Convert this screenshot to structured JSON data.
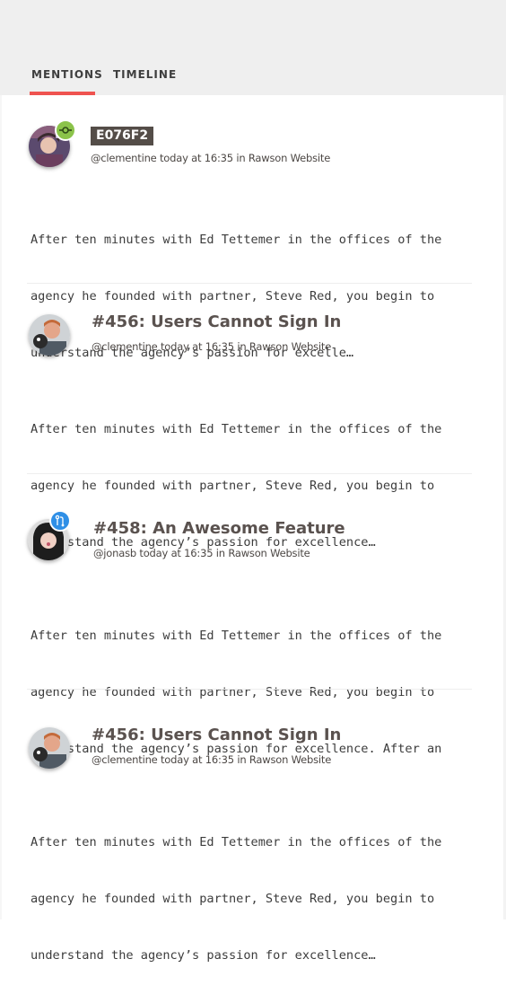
{
  "tabs": [
    {
      "label": "MENTIONS",
      "active": true
    },
    {
      "label": "TIMELINE",
      "active": false
    }
  ],
  "colors": {
    "accent": "#ef5350",
    "commit_badge": "#8bc34a",
    "pr_badge": "#2f8fe6",
    "hash_tag_bg": "#544d48"
  },
  "cards": [
    {
      "title": "E076F2",
      "title_style": "hash-tag",
      "meta": "@clementine today at 16:35 in Rawson Website",
      "badge_icon": "commit-icon",
      "body_lines": [
        "After ten minutes with Ed Tettemer in the offices of the",
        "agency he founded with partner, Steve Red, you begin to",
        "understand the agency’s passion for excelle…"
      ]
    },
    {
      "title": "#456: Users Cannot Sign In",
      "meta": "@clementine today at 16:35 in Rawson Website",
      "body_lines": [
        "After ten minutes with Ed Tettemer in the offices of the",
        "agency he founded with partner, Steve Red, you begin to",
        "understand the agency’s passion for excellence…"
      ]
    },
    {
      "title": "#458: An Awesome Feature",
      "meta": "@jonasb today at 16:35 in Rawson Website",
      "badge_icon": "pull-request-icon",
      "body_lines": [
        "After ten minutes with Ed Tettemer in the offices of the",
        "agency he founded with partner, Steve Red, you begin to",
        "understand the agency’s passion for excellence. After an"
      ]
    },
    {
      "title": "#456: Users Cannot Sign In",
      "meta": "@clementine today at 16:35 in Rawson Website",
      "body_lines": [
        "After ten minutes with Ed Tettemer in the offices of the",
        "agency he founded with partner, Steve Red, you begin to",
        "understand the agency’s passion for excellence…"
      ]
    }
  ]
}
